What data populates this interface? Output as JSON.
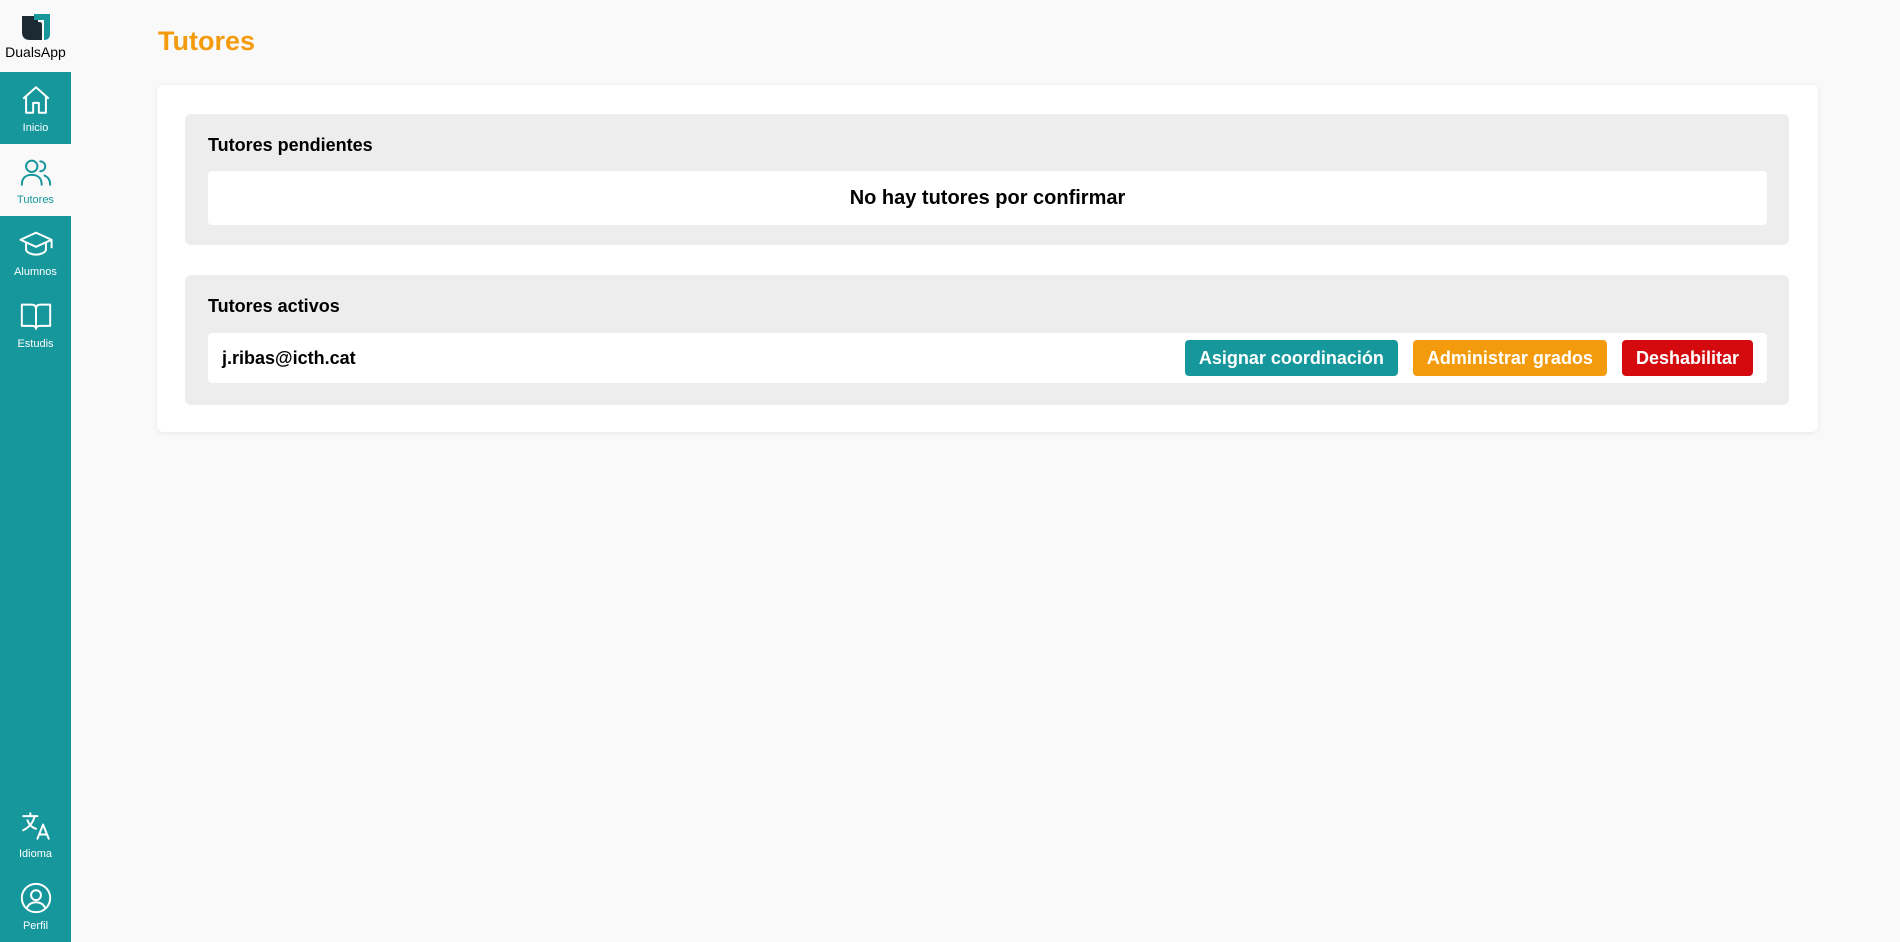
{
  "app": {
    "name": "DualsApp"
  },
  "sidebar": {
    "items": [
      {
        "label": "Inicio",
        "icon": "home-icon",
        "active": false
      },
      {
        "label": "Tutores",
        "icon": "users-icon",
        "active": true
      },
      {
        "label": "Alumnos",
        "icon": "graduation-cap-icon",
        "active": false
      },
      {
        "label": "Estudis",
        "icon": "book-icon",
        "active": false
      }
    ],
    "bottom_items": [
      {
        "label": "Idioma",
        "icon": "language-icon"
      },
      {
        "label": "Perfil",
        "icon": "user-circle-icon"
      }
    ]
  },
  "page": {
    "title": "Tutores"
  },
  "pending": {
    "title": "Tutores pendientes",
    "empty_message": "No hay tutores por confirmar"
  },
  "active": {
    "title": "Tutores activos",
    "tutors": [
      {
        "email": "j.ribas@icth.cat",
        "assign_label": "Asignar coordinación",
        "grades_label": "Administrar grados",
        "disable_label": "Deshabilitar"
      }
    ]
  },
  "colors": {
    "sidebar": "#16979c",
    "title_accent": "#f39b0d",
    "assign_button": "#16979c",
    "grades_button": "#f39b0d",
    "disable_button": "#d40a0f"
  }
}
